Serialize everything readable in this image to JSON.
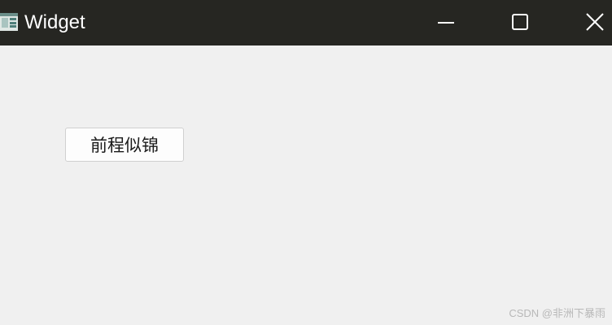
{
  "window": {
    "title": "Widget",
    "app_icon": "qt-widget-app-icon",
    "controls": {
      "minimize_icon": "minimize-icon",
      "maximize_icon": "maximize-icon",
      "close_icon": "close-icon"
    }
  },
  "content": {
    "button_label": "前程似锦"
  },
  "watermark": {
    "text": "CSDN @非洲下暴雨"
  },
  "colors": {
    "titlebar_bg": "#262622",
    "client_bg": "#f0f0f0",
    "button_bg": "#fdfdfd",
    "button_border": "#d0d0d0"
  }
}
